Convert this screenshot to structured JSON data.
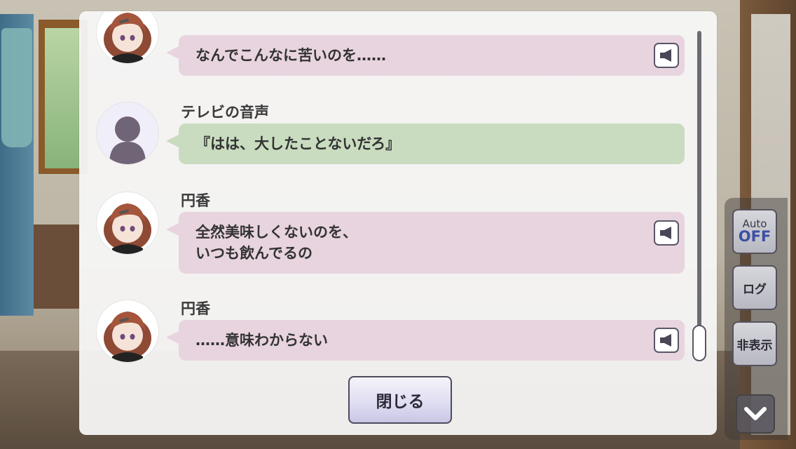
{
  "scene": {
    "description_icon": "blurred-room-background"
  },
  "side_menu": {
    "auto_label_top": "Auto",
    "auto_label_state": "OFF",
    "log_label": "ログ",
    "hide_label": "非表示",
    "chevron_icon": "chevron-down-icon"
  },
  "log": {
    "entries": [
      {
        "speaker": "",
        "text_lines": [
          "なんでこんなに苦いのを……"
        ],
        "color": "#e8d4df",
        "avatar": "girl-avatar",
        "has_voice": true
      },
      {
        "speaker": "テレビの音声",
        "text_lines": [
          "『はは、大したことないだろ』"
        ],
        "color": "#c9dcc0",
        "avatar": "silhouette-avatar",
        "has_voice": false
      },
      {
        "speaker": "円香",
        "text_lines": [
          "全然美味しくないのを、",
          "いつも飲んでるの"
        ],
        "color": "#e8d4df",
        "avatar": "girl-avatar",
        "has_voice": true
      },
      {
        "speaker": "円香",
        "text_lines": [
          "……意味わからない"
        ],
        "color": "#e8d4df",
        "avatar": "girl-avatar",
        "has_voice": true
      }
    ],
    "voice_icon": "speaker-icon"
  },
  "close_button": {
    "label": "閉じる"
  }
}
